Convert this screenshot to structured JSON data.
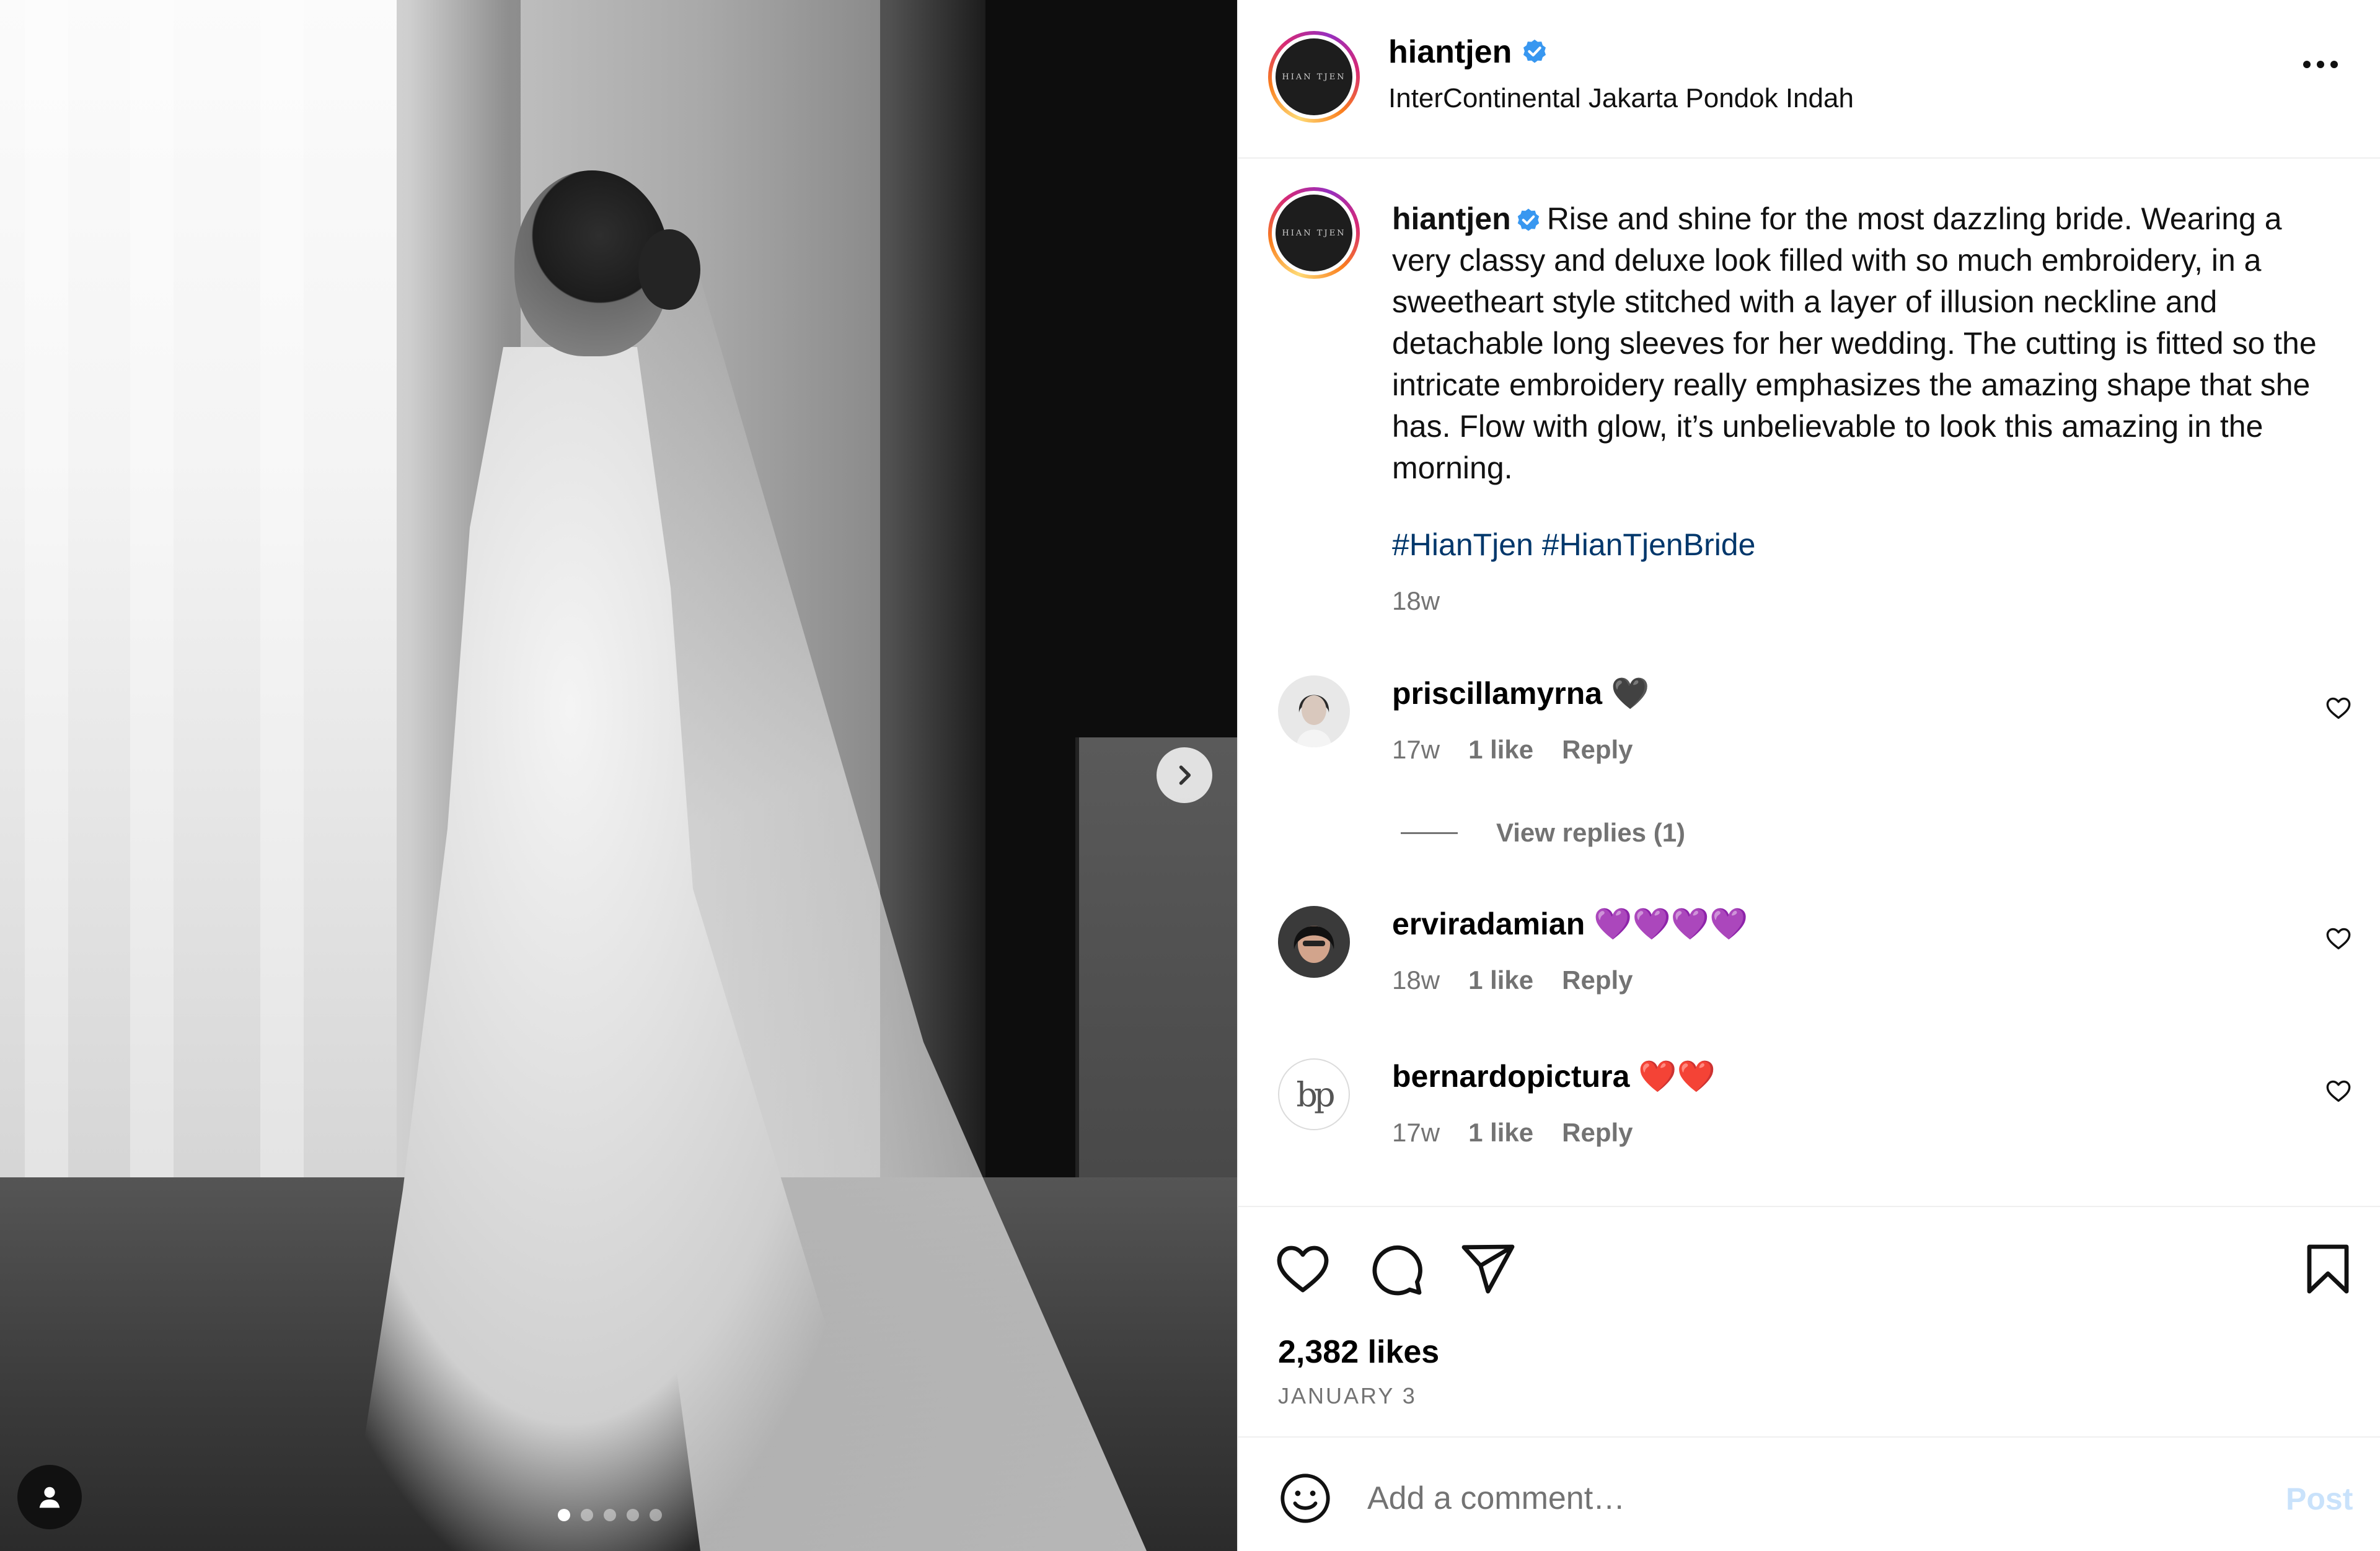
{
  "post": {
    "author": "hiantjen",
    "location": "InterContinental Jakarta Pondok Indah",
    "avatar_logo_text": "HIAN TJEN",
    "caption": "Rise and shine for the most dazzling bride. Wearing a very classy and deluxe look filled with so much embroidery, in a sweetheart style stitched with a layer of illusion neckline and detachable long sleeves for her wedding. The cutting is fitted so the intricate embroidery really emphasizes the amazing shape that she has. Flow with glow, it’s unbelievable to look this amazing in the morning.",
    "hashtags": "#HianTjen #HianTjenBride",
    "time": "18w",
    "likes": "2,382 likes",
    "date": "JANUARY 3"
  },
  "carousel": {
    "total_slides": 5,
    "active_slide": 1
  },
  "comments": [
    {
      "user": "priscillamyrna",
      "text": "🖤",
      "time": "17w",
      "likes": "1 like",
      "reply": "Reply"
    },
    {
      "user": "erviradamian",
      "text": "💜💜💜💜",
      "time": "18w",
      "likes": "1 like",
      "reply": "Reply"
    },
    {
      "user": "bernardopictura",
      "text": "❤️❤️",
      "time": "17w",
      "likes": "1 like",
      "reply": "Reply",
      "avatar_text": "bp"
    }
  ],
  "view_replies": "View replies (1)",
  "add_comment": {
    "placeholder": "Add a comment…",
    "post_label": "Post"
  },
  "icons": {
    "verified": "verified-badge-icon",
    "more": "more-options-icon",
    "like": "heart-icon",
    "comment": "comment-icon",
    "share": "share-icon",
    "save": "bookmark-icon",
    "emoji": "emoji-icon",
    "next": "chevron-right-icon",
    "tag": "user-tag-icon"
  },
  "colors": {
    "verified": "#3897f0",
    "hashtag": "#00376b",
    "muted": "#737373",
    "post_button": "#c9e2fb"
  }
}
